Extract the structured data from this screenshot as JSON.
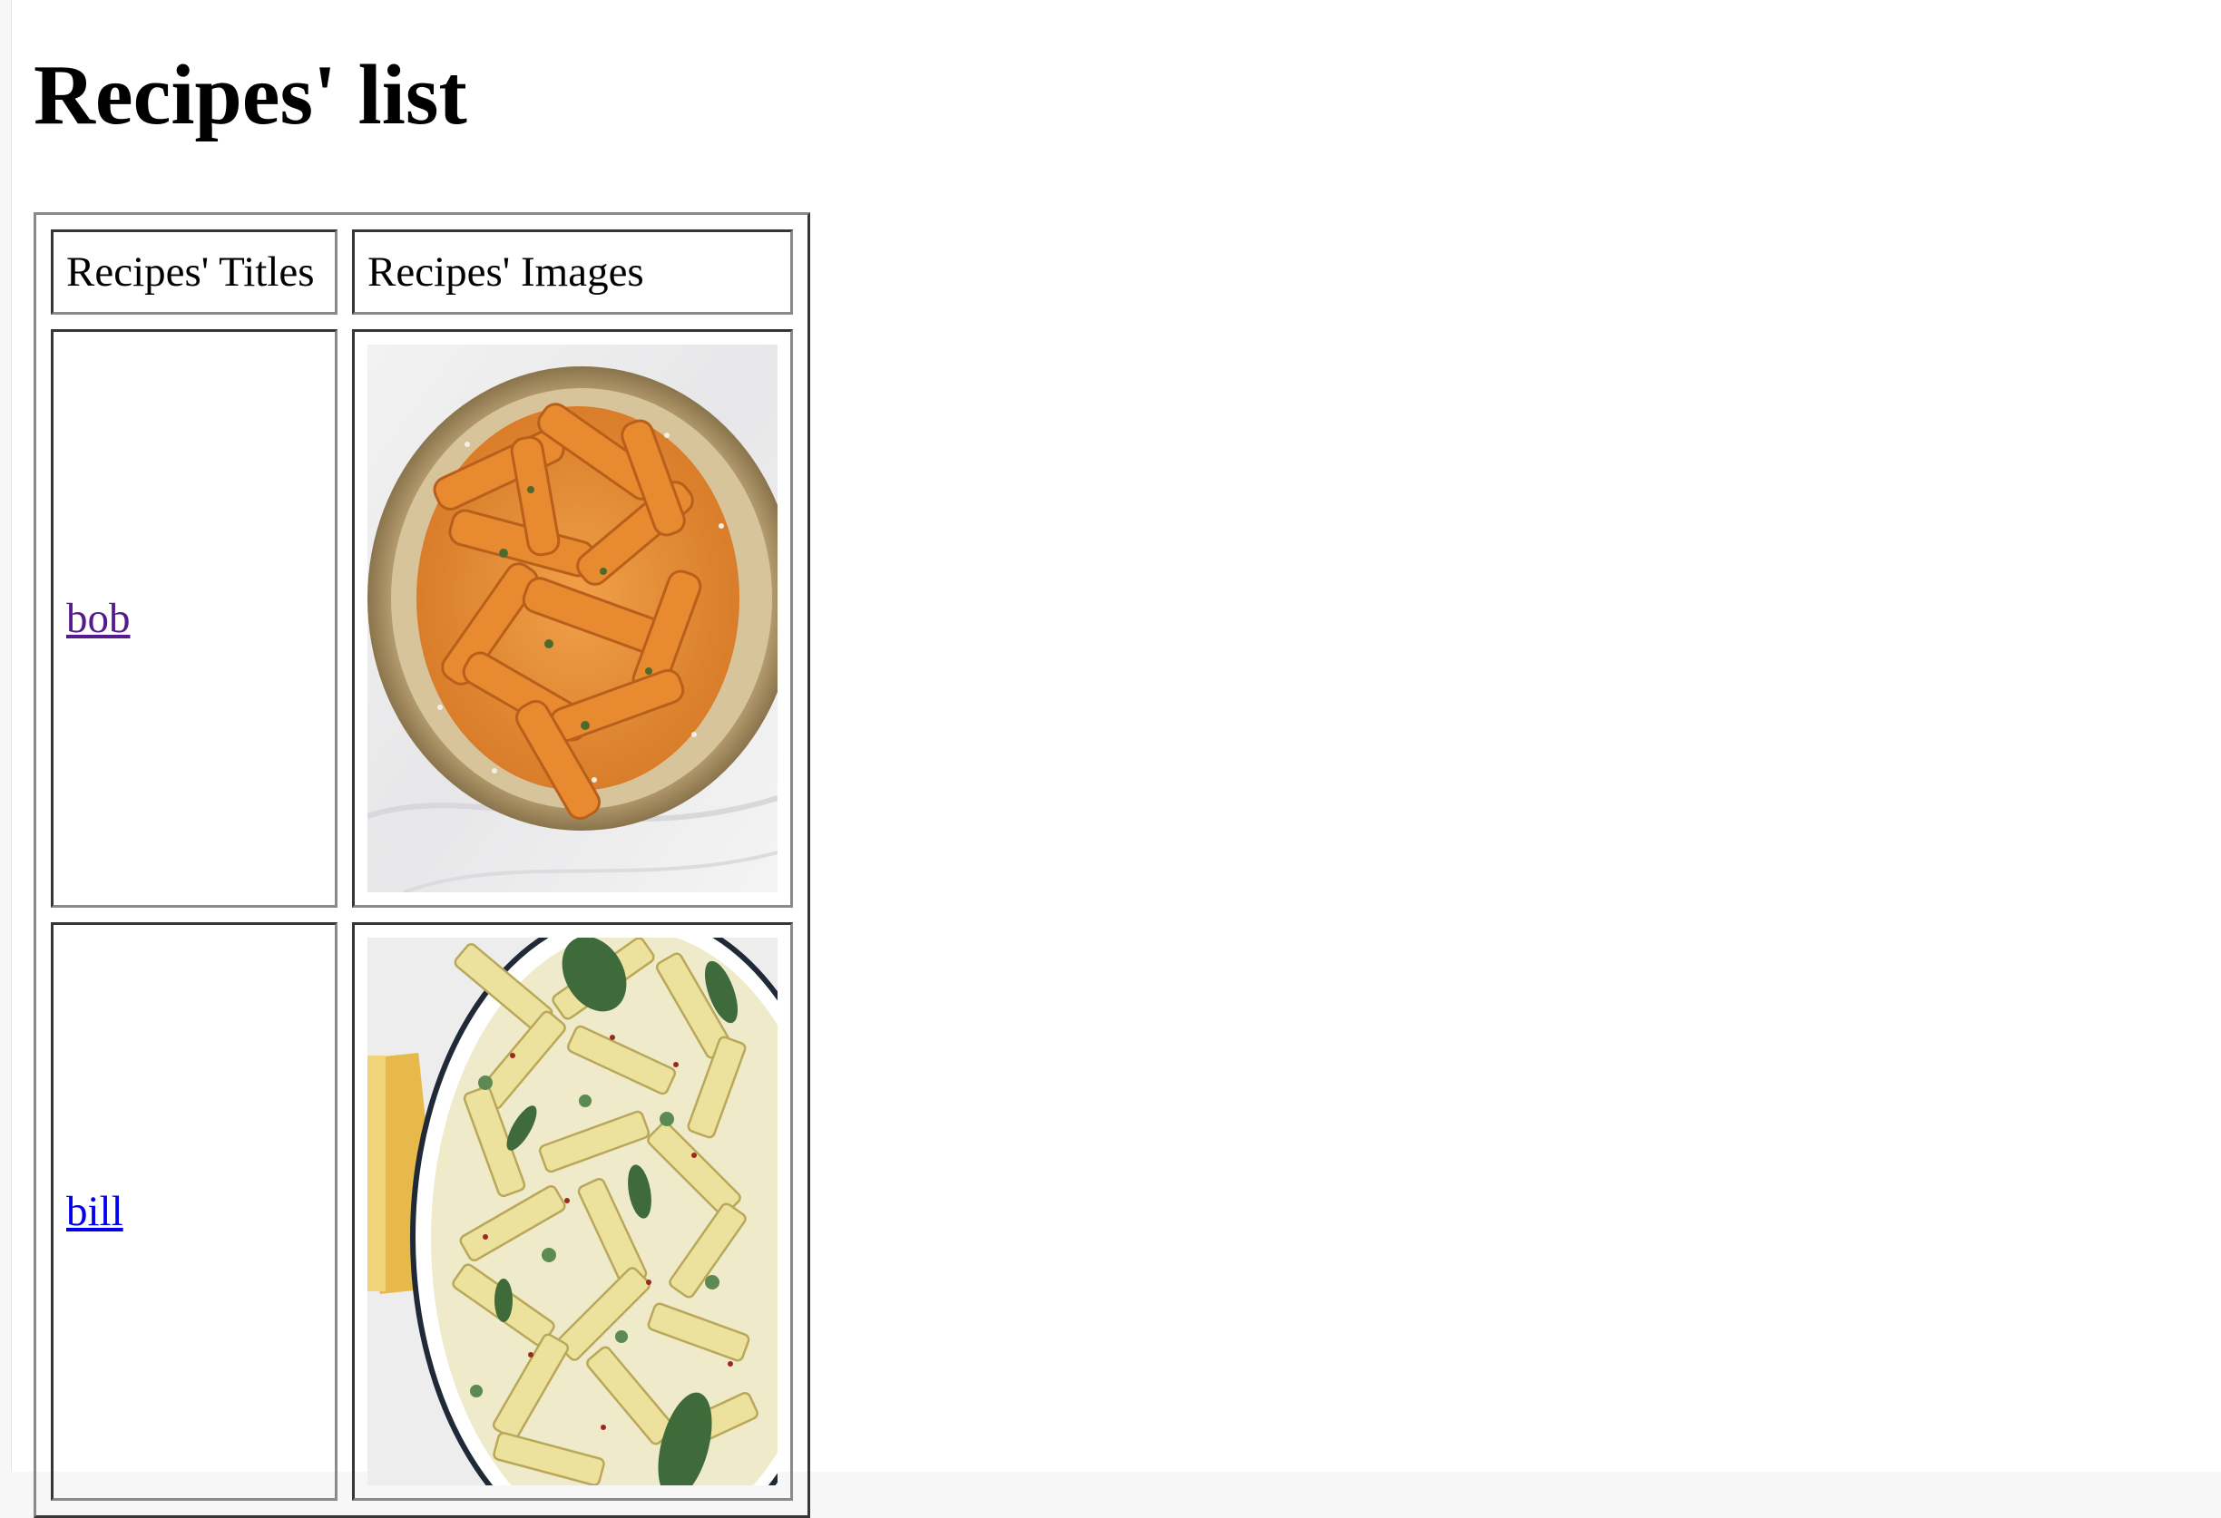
{
  "page": {
    "title": "Recipes' list"
  },
  "table": {
    "headers": [
      "Recipes' Titles",
      "Recipes' Images"
    ],
    "rows": [
      {
        "title": "bob",
        "image_alt": "Penne in creamy tomato sauce",
        "link_state": "visited"
      },
      {
        "title": "bill",
        "image_alt": "Penne with creamy pesto and basil",
        "link_state": "unvisited"
      }
    ]
  },
  "colors": {
    "link_visited": "#551a8b",
    "link_unvisited": "#0000ee"
  }
}
